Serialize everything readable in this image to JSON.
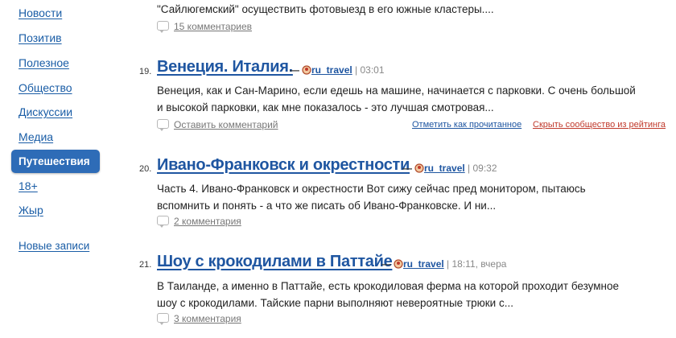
{
  "sidebar": {
    "items": [
      {
        "label": "Новости"
      },
      {
        "label": "Позитив"
      },
      {
        "label": "Полезное"
      },
      {
        "label": "Общество"
      },
      {
        "label": "Дискуссии"
      },
      {
        "label": "Медиа"
      },
      {
        "label": "Путешествия",
        "active": true
      },
      {
        "label": "18+"
      },
      {
        "label": "Жыр"
      }
    ],
    "new_posts": "Новые записи"
  },
  "prev_post": {
    "excerpt": "\"Сайлюгемский\" осуществить фотовыезд в его южные кластеры....",
    "comments": "15 комментариев"
  },
  "posts": [
    {
      "number": "19.",
      "title": "Венеция. Италия.",
      "community": "ru_travel",
      "time": "| 03:01",
      "excerpt_lines": [
        "Венеция, как и Сан-Марино, если едешь на машине, начинается с парковки. С очень большой",
        "и высокой парковки, как мне показалось - это лучшая смотровая..."
      ],
      "comments": "Оставить комментарий",
      "mark_read": "Отметить как прочитанное",
      "hide_community": "Скрыть сообщество из рейтинга"
    },
    {
      "number": "20.",
      "title": "Ивано-Франковск и окрестности",
      "community": "ru_travel",
      "time": "| 09:32",
      "excerpt_lines": [
        "Часть 4. Ивано-Франковск и окрестности Вот сижу сейчас пред монитором, пытаюсь",
        "вспомнить и понять - а что же писать об Ивано-Франковске. И ни..."
      ],
      "comments": "2 комментария"
    },
    {
      "number": "21.",
      "title": "Шоу с крокодилами в Паттайе",
      "community": "ru_travel",
      "time": "| 18:11, вчера",
      "excerpt_lines": [
        "В Таиланде, а именно в Паттайе, есть крокодиловая ферма на которой проходит безумное",
        "шоу с крокодилами. Тайские парни выполняют невероятные трюки с..."
      ],
      "comments": "3 комментария"
    }
  ],
  "byline_dash": "—",
  "colors": {
    "link": "#1f56a1",
    "active_nav_bg": "#2e6cb7",
    "hide_link": "#c0392b",
    "mark_read_link": "#1f56a1"
  }
}
